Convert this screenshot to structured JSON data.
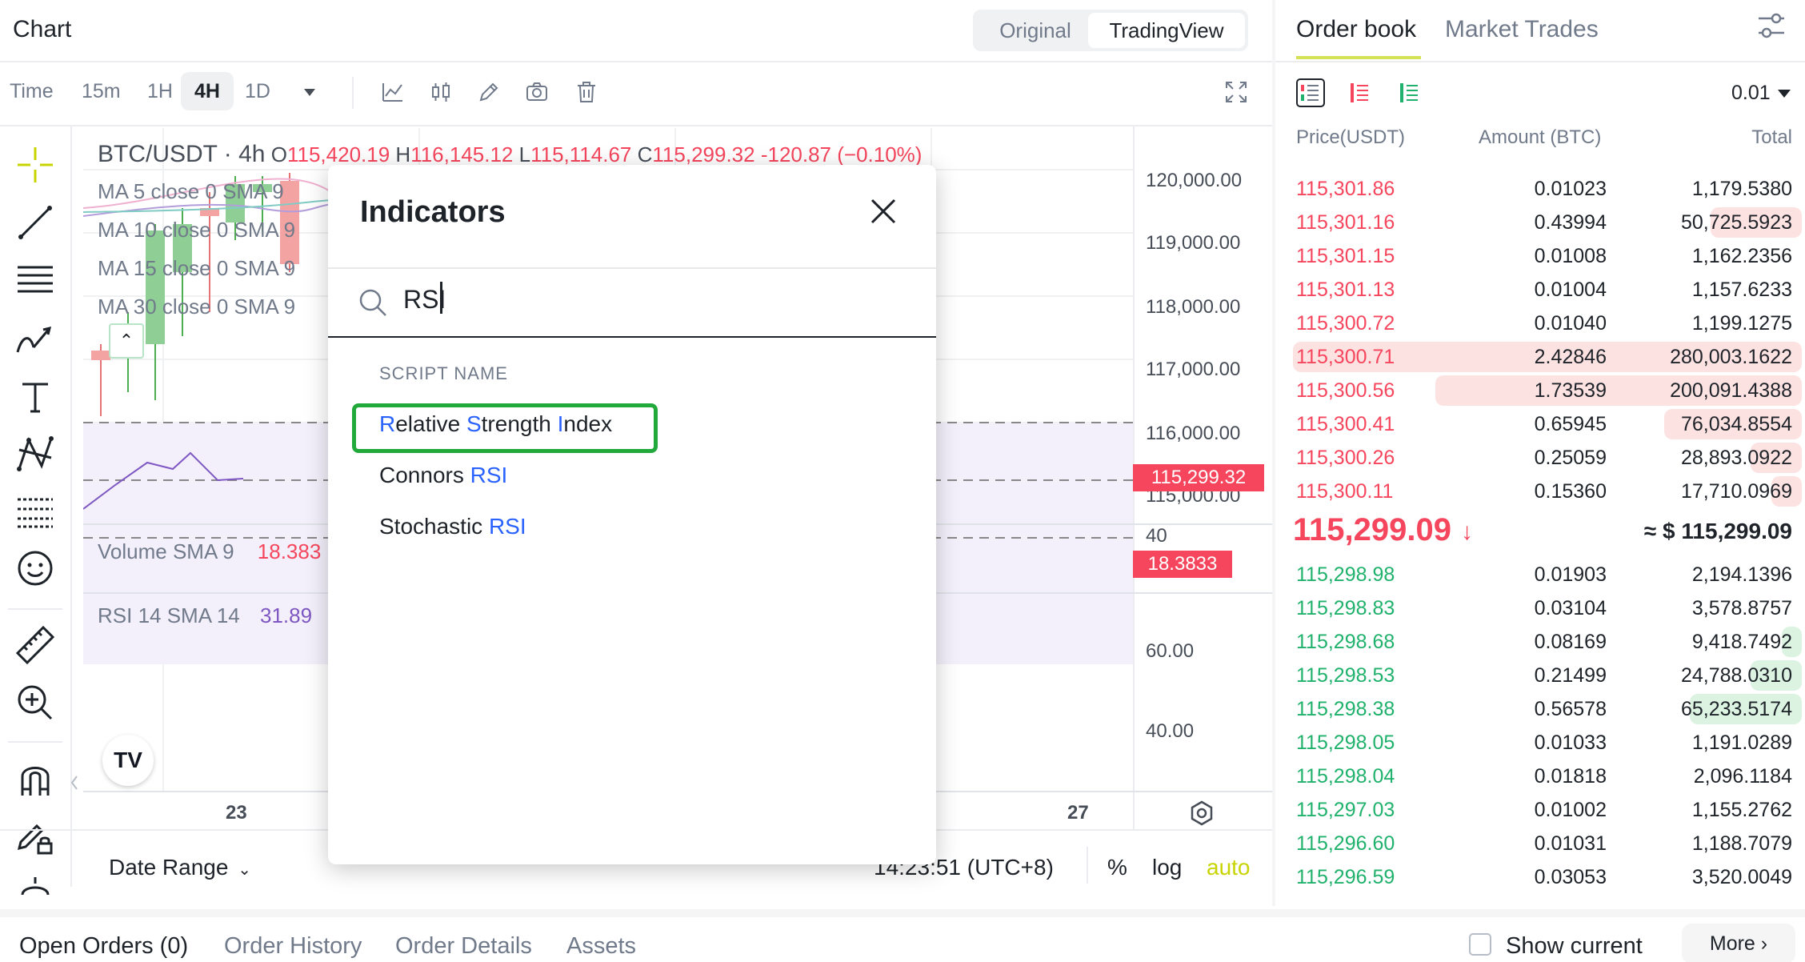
{
  "chart_header": {
    "title": "Chart",
    "view_options": [
      "Original",
      "TradingView"
    ],
    "active_view": "TradingView"
  },
  "toolbar": {
    "time_label": "Time",
    "timeframes": [
      "15m",
      "1H",
      "4H",
      "1D"
    ],
    "active_timeframe": "4H"
  },
  "chart": {
    "symbol": "BTC/USDT · 4h",
    "ohlc": {
      "o_label": "O",
      "o": "115,420.19",
      "h_label": "H",
      "h": "116,145.12",
      "l_label": "L",
      "l": "115,114.67",
      "c_label": "C",
      "c": "115,299.32",
      "change": "-120.87 (−0.10%)"
    },
    "ma_lines": [
      "MA 5 close 0 SMA 9",
      "MA 10 close 0 SMA 9",
      "MA 15 close 0 SMA 9",
      "MA 30 close 0 SMA 9"
    ],
    "price_axis": [
      "120,000.00",
      "119,000.00",
      "118,000.00",
      "117,000.00",
      "116,000.00",
      "115,000.00"
    ],
    "last_price_tag": "115,299.32",
    "volume_label": "Volume SMA 9",
    "volume_value": "18.383",
    "volume_axis": "40",
    "volume_tag": "18.3833",
    "rsi_label": "RSI 14 SMA 14",
    "rsi_value": "31.89",
    "rsi_axis": [
      "60.00",
      "40.00"
    ],
    "date_axis": [
      "23",
      "27"
    ],
    "date_range_label": "Date Range",
    "clock": "14:23:51 (UTC+8)",
    "scale_options": [
      "%",
      "log",
      "auto"
    ],
    "colors": {
      "up": "#26a69a",
      "down": "#f6465d",
      "auto_active": "#c8d400"
    }
  },
  "modal": {
    "title": "Indicators",
    "search_value": "RSI",
    "section_label": "SCRIPT NAME",
    "results": [
      {
        "parts": [
          [
            "R",
            true
          ],
          [
            "elative ",
            false
          ],
          [
            "S",
            true
          ],
          [
            "trength ",
            false
          ],
          [
            "I",
            true
          ],
          [
            "ndex",
            false
          ]
        ]
      },
      {
        "parts": [
          [
            "Connors ",
            false
          ],
          [
            "RSI",
            true
          ]
        ]
      },
      {
        "parts": [
          [
            "Stochastic ",
            false
          ],
          [
            "RSI",
            true
          ]
        ]
      }
    ]
  },
  "orderbook": {
    "tabs": [
      "Order book",
      "Market Trades"
    ],
    "active_tab": "Order book",
    "precision": "0.01",
    "headers": {
      "price": "Price(USDT)",
      "amount": "Amount (BTC)",
      "total": "Total"
    },
    "asks": [
      {
        "price": "115,301.86",
        "amount": "0.01023",
        "total": "1,179.5380",
        "depth": 0.0
      },
      {
        "price": "115,301.16",
        "amount": "0.43994",
        "total": "50,725.5923",
        "depth": 0.18
      },
      {
        "price": "115,301.15",
        "amount": "0.01008",
        "total": "1,162.2356",
        "depth": 0.0
      },
      {
        "price": "115,301.13",
        "amount": "0.01004",
        "total": "1,157.6233",
        "depth": 0.0
      },
      {
        "price": "115,300.72",
        "amount": "0.01040",
        "total": "1,199.1275",
        "depth": 0.0
      },
      {
        "price": "115,300.71",
        "amount": "2.42846",
        "total": "280,003.1622",
        "depth": 1.0
      },
      {
        "price": "115,300.56",
        "amount": "1.73539",
        "total": "200,091.4388",
        "depth": 0.72
      },
      {
        "price": "115,300.41",
        "amount": "0.65945",
        "total": "76,034.8554",
        "depth": 0.27
      },
      {
        "price": "115,300.26",
        "amount": "0.25059",
        "total": "28,893.0922",
        "depth": 0.1
      },
      {
        "price": "115,300.11",
        "amount": "0.15360",
        "total": "17,710.0969",
        "depth": 0.06
      }
    ],
    "mid_price": "115,299.09",
    "mid_usd": "≈ $ 115,299.09",
    "bids": [
      {
        "price": "115,298.98",
        "amount": "0.01903",
        "total": "2,194.1396",
        "depth": 0.0
      },
      {
        "price": "115,298.83",
        "amount": "0.03104",
        "total": "3,578.8757",
        "depth": 0.0
      },
      {
        "price": "115,298.68",
        "amount": "0.08169",
        "total": "9,418.7492",
        "depth": 0.04
      },
      {
        "price": "115,298.53",
        "amount": "0.21499",
        "total": "24,788.0310",
        "depth": 0.1
      },
      {
        "price": "115,298.38",
        "amount": "0.56578",
        "total": "65,233.5174",
        "depth": 0.22
      },
      {
        "price": "115,298.05",
        "amount": "0.01033",
        "total": "1,191.0289",
        "depth": 0.0
      },
      {
        "price": "115,298.04",
        "amount": "0.01818",
        "total": "2,096.1184",
        "depth": 0.0
      },
      {
        "price": "115,297.03",
        "amount": "0.01002",
        "total": "1,155.2762",
        "depth": 0.0
      },
      {
        "price": "115,296.60",
        "amount": "0.01031",
        "total": "1,188.7079",
        "depth": 0.0
      },
      {
        "price": "115,296.59",
        "amount": "0.03053",
        "total": "3,520.0049",
        "depth": 0.0
      }
    ]
  },
  "bottom_tabs": {
    "tabs": [
      "Open Orders (0)",
      "Order History",
      "Order Details",
      "Assets"
    ],
    "show_current": "Show current",
    "more": "More"
  }
}
